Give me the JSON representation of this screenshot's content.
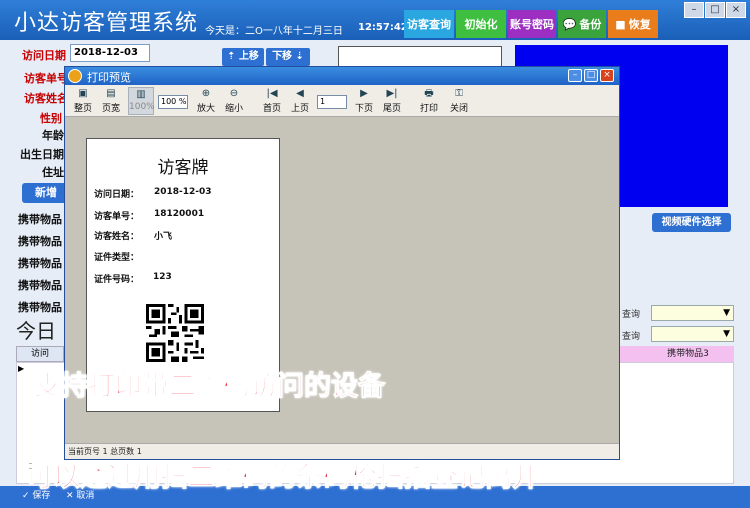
{
  "header": {
    "app_title": "小达访客管理系统",
    "date_text": "今天是：二O一八年十二月三日",
    "time_text": "12:57:42",
    "buttons": {
      "visitor_query": "访客查询",
      "init": "初始化",
      "account_password": "账号密码",
      "backup": "备份",
      "restore": "恢复"
    },
    "window_controls": {
      "minimize": "–",
      "maximize": "□",
      "close": "×"
    }
  },
  "form": {
    "visit_date_label": "访问日期",
    "visit_date_value": "2018-12-03",
    "visitor_no_label": "访客单号",
    "visitor_name_label": "访客姓名",
    "gender_label": "性别",
    "age_label": "年龄",
    "birth_date_label": "出生日期",
    "address_label": "住址",
    "up_button": "上移",
    "down_button": "下移",
    "new_button": "新增",
    "video_hw_button": "视频硬件选择",
    "carry_items": [
      "携带物品",
      "携带物品",
      "携带物品",
      "携带物品",
      "携带物品"
    ],
    "today_label": "今日",
    "query_labels": [
      "查询",
      "查询"
    ],
    "grid_header_left": "访问",
    "grid_header_right": "携带物品3",
    "scroll_zero": "0",
    "save_button": "保存",
    "cancel_button": "取消"
  },
  "preview": {
    "title": "打印预览",
    "toolbar": {
      "full_page": "整页",
      "page_width": "页宽",
      "hundred": "100%",
      "zoom_value": "100 %",
      "zoom_in": "放大",
      "zoom_out": "缩小",
      "first": "首页",
      "prev": "上页",
      "page_value": "1",
      "next": "下页",
      "last": "尾页",
      "print": "打印",
      "close": "关闭"
    },
    "page": {
      "title": "访客牌",
      "rows": [
        {
          "label": "访问日期：",
          "value": "2018-12-03"
        },
        {
          "label": "访客单号：",
          "value": "18120001"
        },
        {
          "label": "访客姓名：",
          "value": "小飞"
        },
        {
          "label": "证件类型：",
          "value": ""
        },
        {
          "label": "证件号码：",
          "value": "123"
        }
      ]
    },
    "status": "当前页号 1  总页数 1"
  },
  "captions": {
    "line1": "支持打印带二维码访问的设备",
    "line2": "可以通过用扫二维码的条码枪扫描登记离开"
  },
  "colors": {
    "header": "#1a5fb8",
    "camera": "#0000f0",
    "caption": "#e8142a",
    "accent_button": "#2e6fd2"
  }
}
